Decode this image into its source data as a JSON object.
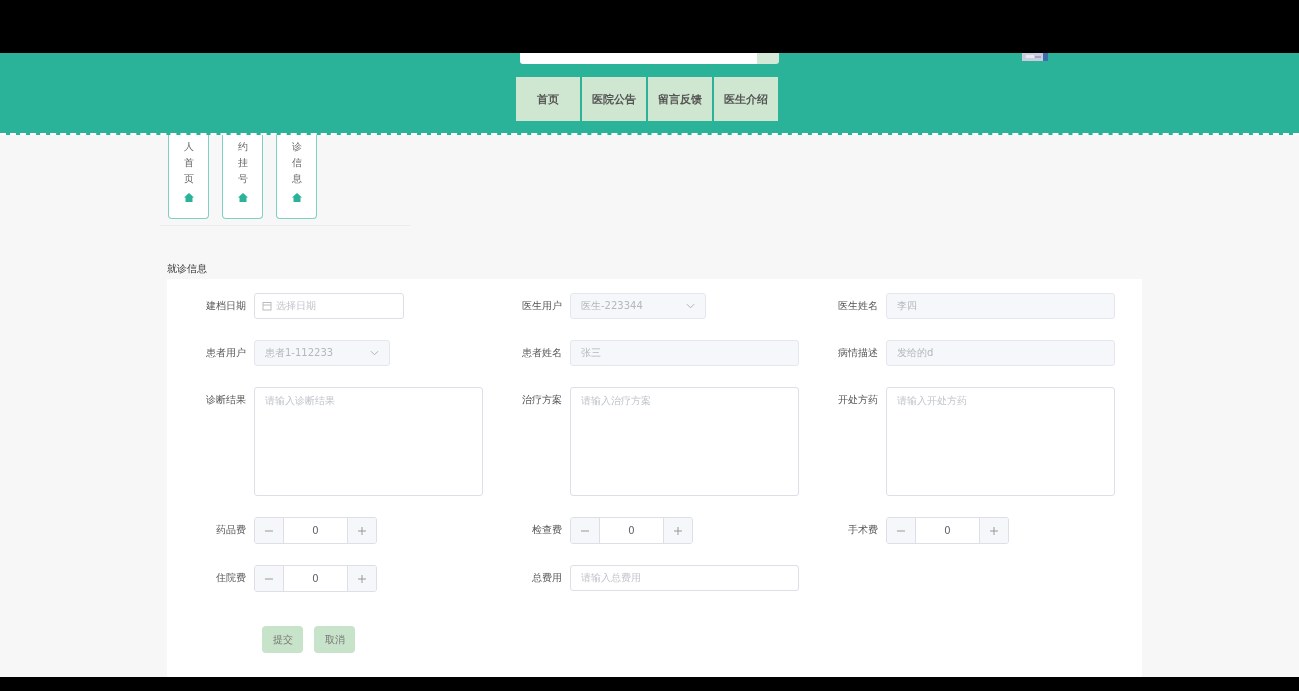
{
  "nav": [
    "首页",
    "医院公告",
    "留言反馈",
    "医生介绍"
  ],
  "side_cards": [
    {
      "label": "人首页"
    },
    {
      "label": "约挂号"
    },
    {
      "label": "诊信息"
    }
  ],
  "section_title": "就诊信息",
  "form_rows": [
    [
      {
        "label": "建档日期",
        "kind": "date",
        "placeholder": "选择日期"
      },
      {
        "label": "医生用户",
        "kind": "select",
        "value": "医生-223344",
        "disabled": true
      },
      {
        "label": "医生姓名",
        "kind": "text",
        "value": "李四",
        "disabled": true
      }
    ],
    [
      {
        "label": "患者用户",
        "kind": "select",
        "value": "患者1-112233",
        "disabled": true
      },
      {
        "label": "患者姓名",
        "kind": "text",
        "value": "张三",
        "disabled": true
      },
      {
        "label": "病情描述",
        "kind": "text",
        "value": "发给的d",
        "disabled": true
      }
    ],
    [
      {
        "label": "诊断结果",
        "kind": "textarea",
        "placeholder": "请输入诊断结果"
      },
      {
        "label": "治疗方案",
        "kind": "textarea",
        "placeholder": "请输入治疗方案"
      },
      {
        "label": "开处方药",
        "kind": "textarea",
        "placeholder": "请输入开处方药"
      }
    ],
    [
      {
        "label": "药品费",
        "kind": "number",
        "value": "0"
      },
      {
        "label": "检查费",
        "kind": "number",
        "value": "0"
      },
      {
        "label": "手术费",
        "kind": "number",
        "value": "0"
      }
    ],
    [
      {
        "label": "住院费",
        "kind": "number",
        "value": "0"
      },
      {
        "label": "总费用",
        "kind": "text",
        "placeholder": "请输入总费用"
      }
    ]
  ],
  "buttons": [
    "提交",
    "取消"
  ]
}
